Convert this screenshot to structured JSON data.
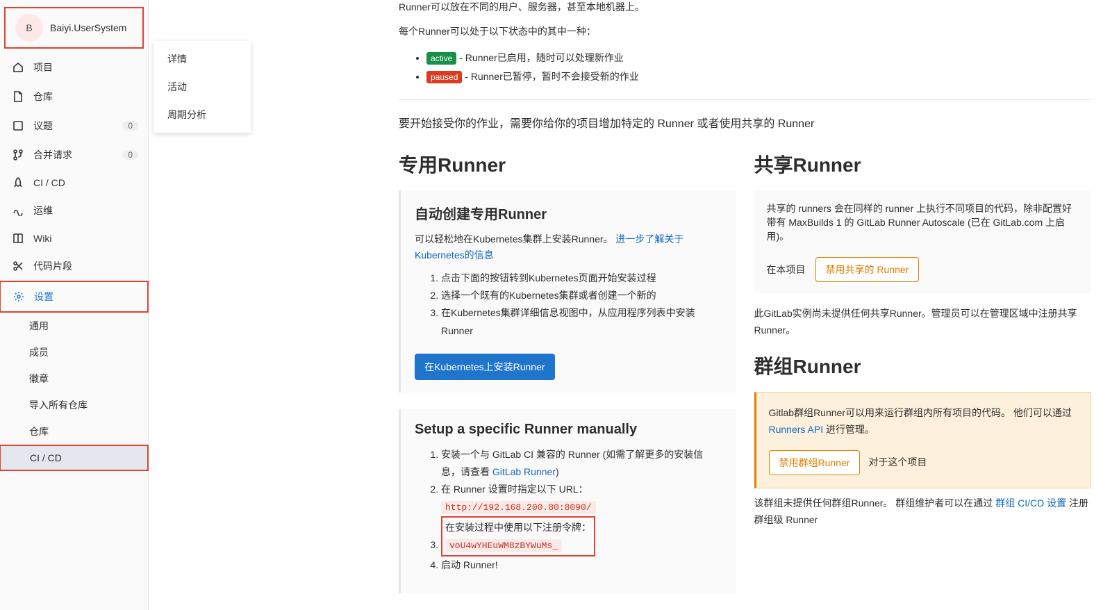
{
  "project": {
    "initial": "B",
    "name": "Baiyi.UserSystem"
  },
  "sidebar": {
    "items": [
      {
        "label": "项目"
      },
      {
        "label": "仓库"
      },
      {
        "label": "议题",
        "badge": "0"
      },
      {
        "label": "合并请求",
        "badge": "0"
      },
      {
        "label": "CI / CD"
      },
      {
        "label": "运维"
      },
      {
        "label": "Wiki"
      },
      {
        "label": "代码片段"
      },
      {
        "label": "设置"
      }
    ],
    "settings_sub": [
      {
        "label": "通用"
      },
      {
        "label": "成员"
      },
      {
        "label": "徽章"
      },
      {
        "label": "导入所有仓库"
      },
      {
        "label": "仓库"
      },
      {
        "label": "CI / CD"
      }
    ]
  },
  "flyout": {
    "a": "详情",
    "b": "活动",
    "c": "周期分析"
  },
  "intro": {
    "line1": "Runner可以放在不同的用户、服务器，甚至本地机器上。",
    "line2": "每个Runner可以处于以下状态中的其中一种：",
    "active_badge": "active",
    "active_text": " - Runner已启用，随时可以处理新作业",
    "paused_badge": "paused",
    "paused_text": " - Runner已暂停，暂时不会接受新的作业",
    "subhead": "要开始接受你的作业，需要你给你的项目增加特定的 Runner 或者使用共享的 Runner"
  },
  "specific": {
    "title": "专用Runner",
    "auto_h": "自动创建专用Runner",
    "auto_p_a": "可以轻松地在Kubernetes集群上安装Runner。 ",
    "auto_link": "进一步了解关于Kubernetes的信息",
    "s1": "点击下面的按钮转到Kubernetes页面开始安装过程",
    "s2": "选择一个既有的Kubernetes集群或者创建一个新的",
    "s3": "在Kubernetes集群详细信息视图中，从应用程序列表中安装Runner",
    "btn": "在Kubernetes上安装Runner",
    "manual_h": "Setup a specific Runner manually",
    "m1_a": "安装一个与 GitLab CI 兼容的 Runner (如需了解更多的安装信息，请查看 ",
    "m1_link": "GitLab Runner",
    "m1_b": ")",
    "m2": "在 Runner 设置时指定以下 URL：",
    "m2_code": "http://192.168.200.80:8090/",
    "m3": "在安装过程中使用以下注册令牌：",
    "m3_code": "voU4wYHEuWM8zBYWuMs_",
    "m4": "启动 Runner!"
  },
  "shared": {
    "title": "共享Runner",
    "desc": "共享的 runners 会在同样的 runner 上执行不同项目的代码，除非配置好带有 MaxBuilds 1 的 GitLab Runner Autoscale (已在 GitLab.com 上启用)。",
    "in_project": "在本项目",
    "disable_btn": "禁用共享的 Runner",
    "note": "此GitLab实例尚未提供任何共享Runner。管理员可以在管理区域中注册共享Runner。"
  },
  "group": {
    "title": "群组Runner",
    "alert_a": "Gitlab群组Runner可以用来运行群组内所有项目的代码。 他们可以通过 ",
    "alert_link": "Runners API",
    "alert_b": " 进行管理。",
    "disable_btn": "禁用群组Runner",
    "for_project": "对于这个项目",
    "note_a": "该群组未提供任何群组Runner。 群组维护者可以在通过 ",
    "note_link": "群组 CI/CD 设置",
    "note_b": " 注册群组级 Runner"
  }
}
